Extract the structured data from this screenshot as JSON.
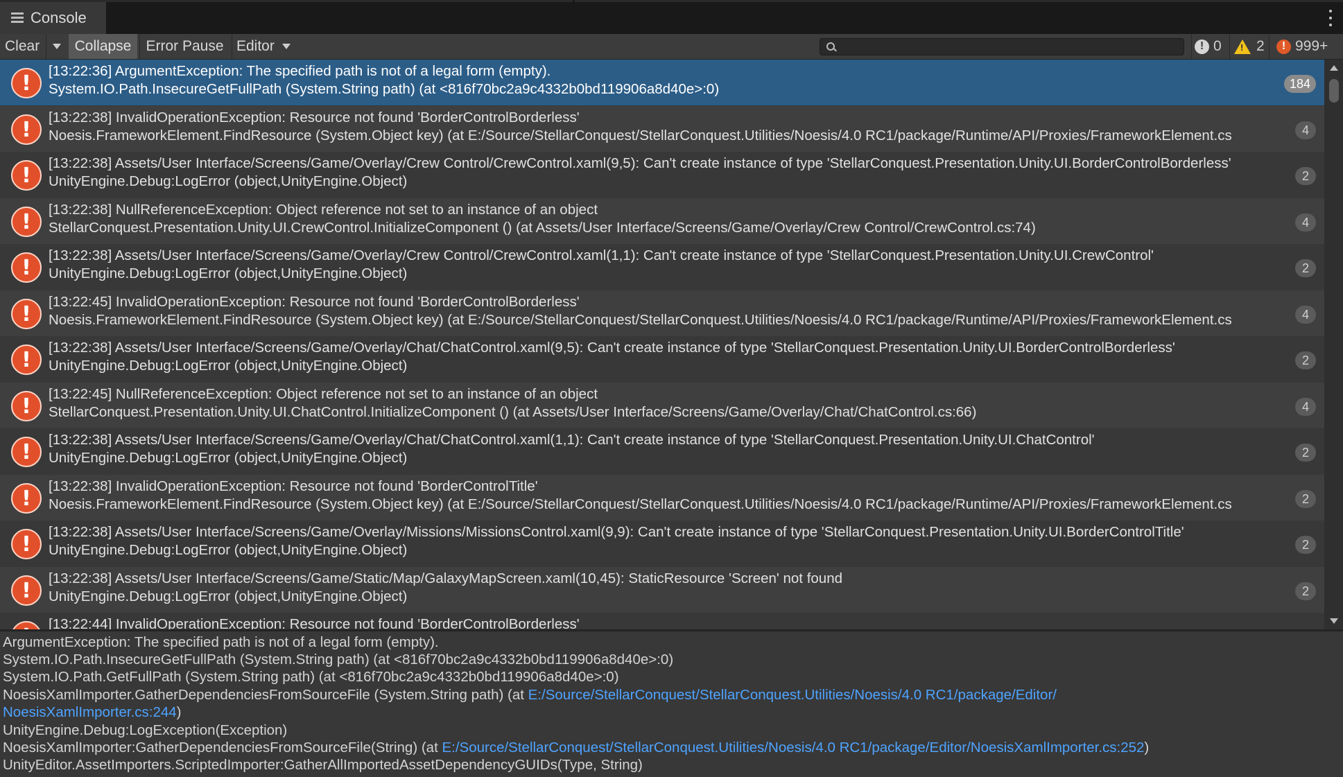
{
  "window": {
    "tab_title": "Console",
    "tab_icon": "console-list-icon"
  },
  "toolbar": {
    "clear_label": "Clear",
    "collapse_label": "Collapse",
    "error_pause_label": "Error Pause",
    "editor_label": "Editor",
    "search_placeholder": "",
    "info_count": "0",
    "warning_count": "2",
    "error_count": "999+"
  },
  "log_entries": [
    {
      "line1": "[13:22:36] ArgumentException: The specified path is not of a legal form (empty).",
      "line2": "System.IO.Path.InsecureGetFullPath (System.String path) (at <816f70bc2a9c4332b0bd119906a8d40e>:0)",
      "count": "184",
      "selected": true
    },
    {
      "line1": "[13:22:38] InvalidOperationException: Resource not found 'BorderControlBorderless'",
      "line2": "Noesis.FrameworkElement.FindResource (System.Object key) (at E:/Source/StellarConquest/StellarConquest.Utilities/Noesis/4.0 RC1/package/Runtime/API/Proxies/FrameworkElement.cs",
      "count": "4"
    },
    {
      "line1": "[13:22:38] Assets/User Interface/Screens/Game/Overlay/Crew Control/CrewControl.xaml(9,5): Can't create instance of type 'StellarConquest.Presentation.Unity.UI.BorderControlBorderless'",
      "line2": "UnityEngine.Debug:LogError (object,UnityEngine.Object)",
      "count": "2"
    },
    {
      "line1": "[13:22:38] NullReferenceException: Object reference not set to an instance of an object",
      "line2": "StellarConquest.Presentation.Unity.UI.CrewControl.InitializeComponent () (at Assets/User Interface/Screens/Game/Overlay/Crew Control/CrewControl.cs:74)",
      "count": "4"
    },
    {
      "line1": "[13:22:38] Assets/User Interface/Screens/Game/Overlay/Crew Control/CrewControl.xaml(1,1): Can't create instance of type 'StellarConquest.Presentation.Unity.UI.CrewControl'",
      "line2": "UnityEngine.Debug:LogError (object,UnityEngine.Object)",
      "count": "2"
    },
    {
      "line1": "[13:22:45] InvalidOperationException: Resource not found 'BorderControlBorderless'",
      "line2": "Noesis.FrameworkElement.FindResource (System.Object key) (at E:/Source/StellarConquest/StellarConquest.Utilities/Noesis/4.0 RC1/package/Runtime/API/Proxies/FrameworkElement.cs",
      "count": "4"
    },
    {
      "line1": "[13:22:38] Assets/User Interface/Screens/Game/Overlay/Chat/ChatControl.xaml(9,5): Can't create instance of type 'StellarConquest.Presentation.Unity.UI.BorderControlBorderless'",
      "line2": "UnityEngine.Debug:LogError (object,UnityEngine.Object)",
      "count": "2"
    },
    {
      "line1": "[13:22:45] NullReferenceException: Object reference not set to an instance of an object",
      "line2": "StellarConquest.Presentation.Unity.UI.ChatControl.InitializeComponent () (at Assets/User Interface/Screens/Game/Overlay/Chat/ChatControl.cs:66)",
      "count": "4"
    },
    {
      "line1": "[13:22:38] Assets/User Interface/Screens/Game/Overlay/Chat/ChatControl.xaml(1,1): Can't create instance of type 'StellarConquest.Presentation.Unity.UI.ChatControl'",
      "line2": "UnityEngine.Debug:LogError (object,UnityEngine.Object)",
      "count": "2"
    },
    {
      "line1": "[13:22:38] InvalidOperationException: Resource not found 'BorderControlTitle'",
      "line2": "Noesis.FrameworkElement.FindResource (System.Object key) (at E:/Source/StellarConquest/StellarConquest.Utilities/Noesis/4.0 RC1/package/Runtime/API/Proxies/FrameworkElement.cs",
      "count": "2"
    },
    {
      "line1": "[13:22:38] Assets/User Interface/Screens/Game/Overlay/Missions/MissionsControl.xaml(9,9): Can't create instance of type 'StellarConquest.Presentation.Unity.UI.BorderControlTitle'",
      "line2": "UnityEngine.Debug:LogError (object,UnityEngine.Object)",
      "count": "2"
    },
    {
      "line1": "[13:22:38] Assets/User Interface/Screens/Game/Static/Map/GalaxyMapScreen.xaml(10,45): StaticResource 'Screen' not found",
      "line2": "UnityEngine.Debug:LogError (object,UnityEngine.Object)",
      "count": "2"
    },
    {
      "line1": "[13:22:44] InvalidOperationException: Resource not found 'BorderControlBorderless'",
      "line2": "",
      "count": ""
    }
  ],
  "detail": {
    "l1": "ArgumentException: The specified path is not of a legal form (empty).",
    "l2": "System.IO.Path.InsecureGetFullPath (System.String path) (at <816f70bc2a9c4332b0bd119906a8d40e>:0)",
    "l3": "System.IO.Path.GetFullPath (System.String path) (at <816f70bc2a9c4332b0bd119906a8d40e>:0)",
    "l4_prefix": "NoesisXamlImporter.GatherDependenciesFromSourceFile (System.String path) (at ",
    "l4_link": "E:/Source/StellarConquest/StellarConquest.Utilities/Noesis/4.0 RC1/package/Editor/",
    "l5_link": "NoesisXamlImporter.cs:244",
    "l5_suffix": ")",
    "l6": "UnityEngine.Debug:LogException(Exception)",
    "l7_prefix": "NoesisXamlImporter:GatherDependenciesFromSourceFile(String) (at ",
    "l7_link": "E:/Source/StellarConquest/StellarConquest.Utilities/Noesis/4.0 RC1/package/Editor/NoesisXamlImporter.cs:252",
    "l7_suffix": ")",
    "l8": "UnityEditor.AssetImporters.ScriptedImporter:GatherAllImportedAssetDependencyGUIDs(Type, String)"
  },
  "colors": {
    "selected_row": "#2c5d87",
    "error_icon": "#e2502b",
    "warning_icon": "#f2c21b",
    "link": "#4ea3ff"
  }
}
